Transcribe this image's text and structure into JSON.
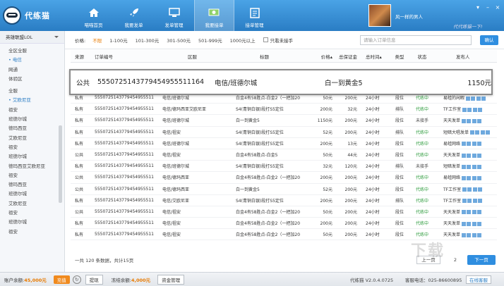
{
  "app": {
    "logo_text": "代练猫",
    "nav": [
      {
        "label": "喵喵首页",
        "icon": "home-icon"
      },
      {
        "label": "我要发单",
        "icon": "rocket-icon"
      },
      {
        "label": "发单管理",
        "icon": "monitor-icon"
      },
      {
        "label": "我要接单",
        "icon": "money-icon"
      },
      {
        "label": "接单管理",
        "icon": "clipboard-icon"
      }
    ],
    "user": {
      "name": "风一样的男人",
      "slogan": "代代练猫一下!"
    }
  },
  "sidebar": {
    "game": "英雄联盟LOL",
    "regions": [
      "全区全服",
      "电信",
      "网通",
      "体验区"
    ],
    "selected_region": "电信",
    "servers": [
      "全服",
      "艾欧尼亚",
      "祖安",
      "班德尔城",
      "德玛西亚",
      "艾欧尼亚",
      "祖安",
      "班德尔城",
      "德玛西亚艾欧尼亚",
      "祖安",
      "德玛西亚",
      "班德尔城",
      "艾欧尼亚",
      "祖安",
      "班德尔城",
      "祖安"
    ],
    "selected_server": "艾欧尼亚"
  },
  "filter": {
    "label": "价格:",
    "options": [
      "不限",
      "1-100元",
      "101-300元",
      "301-500元",
      "501-999元",
      "1000元以上"
    ],
    "selected": "不限",
    "only_not_accepted": "只看未接手",
    "search_placeholder": "请输入订单信息",
    "confirm": "确认"
  },
  "table": {
    "headers": [
      "来源",
      "订单编号",
      "区服",
      "标题",
      "价格",
      "总保证金",
      "总时间",
      "类型",
      "状态",
      "发布人"
    ],
    "rows": [
      [
        "私有",
        "5550725143779454955511164",
        "电信/班德尔城",
        "白金4有58胜点-白金2（一把加20",
        "50元",
        "200元",
        "24小时",
        "段位",
        "代练中",
        "易蛙的闲暇",
        4
      ],
      [
        "私有",
        "5550725143779454955511164",
        "电信/德玛西亚艾欧尼亚",
        "S4(青铜白银)段打S5定位",
        "200元",
        "32元",
        "24小时",
        "排队",
        "代练中",
        "TF工作室",
        4
      ],
      [
        "私有",
        "5550725143779454955511164",
        "电信/班德尔城",
        "白一到黄金5",
        "1150元",
        "200元",
        "24小时",
        "段位",
        "未接手",
        "天天发单",
        4
      ],
      [
        "私有",
        "5550725143779454955511164",
        "电信/祖安",
        "S4(青铜白银)段打S5定位",
        "52元",
        "200元",
        "24小时",
        "排队",
        "代练中",
        "短暗大唱发单",
        4
      ],
      [
        "私有",
        "5550725143779454955511164",
        "电信/班德尔城",
        "S4(青铜白银)段打S5定位",
        "200元",
        "13元",
        "24小时",
        "段位",
        "代练中",
        "易蛙网络",
        4
      ],
      [
        "公共",
        "5550725143779454955511164",
        "电信/祖安",
        "白金4有58胜点-白金5",
        "50元",
        "44元",
        "24小时",
        "段位",
        "代练中",
        "天天发单",
        4
      ],
      [
        "私有",
        "5550725143779454955511164",
        "电信/班德尔城",
        "S4(青铜白银)段打S5定位",
        "32元",
        "120元",
        "24小时",
        "排队",
        "未接手",
        "短暗发单",
        4
      ],
      [
        "公共",
        "5550725143779454955511164",
        "电信/德玛西亚",
        "白金4有58胜点-白金2（一把加20",
        "200元",
        "200元",
        "24小时",
        "段位",
        "代练中",
        "易蛙网络",
        4
      ],
      [
        "公共",
        "5550725143779454955511164",
        "电信/德玛西亚",
        "白一到黄金5",
        "52元",
        "200元",
        "24小时",
        "段位",
        "代练中",
        "TF工作室",
        4
      ],
      [
        "私有",
        "5550725143779454955511164",
        "电信/艾欧尼亚",
        "S4(青铜白银)段打S5定位",
        "200元",
        "200元",
        "24小时",
        "排队",
        "代练中",
        "TF工作室",
        4
      ],
      [
        "公共",
        "5550725143779454955511164",
        "电信/祖安",
        "白金4有58胜点-白金2（一把加20",
        "50元",
        "200元",
        "24小时",
        "段位",
        "代练中",
        "天天发单",
        4
      ],
      [
        "私有",
        "5550725143779454955511164",
        "电信/祖安",
        "白金4有58胜点-白金2（一把加20",
        "200元",
        "200元",
        "24小时",
        "段位",
        "代练中",
        "天天发单",
        4
      ],
      [
        "私有",
        "5550725143779454955511164",
        "电信/祖安",
        "白金4有58胜点-白金2（一把加20",
        "50元",
        "200元",
        "24小时",
        "段位",
        "代练中",
        "天天发单",
        4
      ]
    ]
  },
  "popup": {
    "source": "公共",
    "order": "5550725143779454955511164",
    "region": "电信/班德尔城",
    "title": "白一到黄金5",
    "price": "1150元"
  },
  "pager": {
    "info": "一共 120 条数据，共计15页",
    "prev": "上一页",
    "page": "2",
    "next": "下一页"
  },
  "statusbar": {
    "balance_label": "账户余额:",
    "balance": "45,000元",
    "recharge": "充值",
    "withdraw": "提现",
    "frozen_label": "冻结余额:",
    "frozen": "4,000元",
    "manage": "资金管理",
    "version": "代练猫  V2.0.4.0725",
    "service": "客服电话：025-86600895",
    "online": "在线客服"
  }
}
